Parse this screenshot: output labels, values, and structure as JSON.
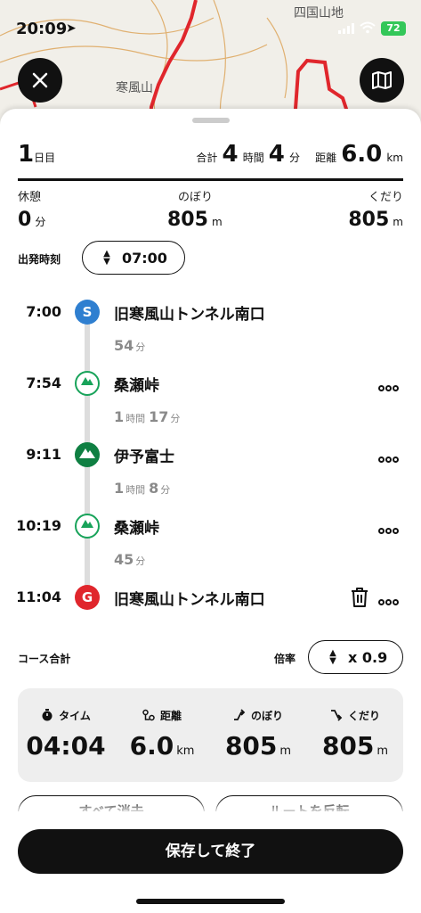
{
  "status_bar": {
    "time": "20:09",
    "battery": "72"
  },
  "map": {
    "labels": [
      "四国山地",
      "寒風山"
    ]
  },
  "header": {
    "day_num": "1",
    "day_unit": "日目",
    "total_label": "合計",
    "hours": "4",
    "hours_unit": "時間",
    "minutes": "4",
    "minutes_unit": "分",
    "distance_label": "距離",
    "distance": "6.0",
    "distance_unit": "km"
  },
  "stats": {
    "rest_label": "休憩",
    "rest_value": "0",
    "rest_unit": "分",
    "up_label": "のぼり",
    "up_value": "805",
    "up_unit": "m",
    "down_label": "くだり",
    "down_value": "805",
    "down_unit": "m"
  },
  "departure": {
    "label": "出発時刻",
    "time": "07:00"
  },
  "timeline": {
    "stops": [
      {
        "time": "7:00",
        "marker": "S",
        "name": "旧寒風山トンネル南口"
      },
      {
        "time": "7:54",
        "name": "桑瀬峠"
      },
      {
        "time": "9:11",
        "name": "伊予富士"
      },
      {
        "time": "10:19",
        "name": "桑瀬峠"
      },
      {
        "time": "11:04",
        "marker": "G",
        "name": "旧寒風山トンネル南口"
      }
    ],
    "segments": [
      {
        "m": "54",
        "m_unit": "分"
      },
      {
        "h": "1",
        "h_unit": "時間",
        "m": "17",
        "m_unit": "分"
      },
      {
        "h": "1",
        "h_unit": "時間",
        "m": "8",
        "m_unit": "分"
      },
      {
        "m": "45",
        "m_unit": "分"
      }
    ]
  },
  "course_total": {
    "label": "コース合計",
    "rate_label": "倍率",
    "rate_value": "x 0.9"
  },
  "summary": {
    "time_label": "タイム",
    "time_value": "04:04",
    "dist_label": "距離",
    "dist_value": "6.0",
    "dist_unit": "km",
    "up_label": "のぼり",
    "up_value": "805",
    "up_unit": "m",
    "down_label": "くだり",
    "down_value": "805",
    "down_unit": "m"
  },
  "actions": {
    "clear_all": "すべて消去",
    "reverse": "ルートを反転",
    "save": "保存して終了"
  },
  "colors": {
    "start": "#2f7fd0",
    "goal": "#e0262c",
    "pass": "#18a35a",
    "peak": "#0f7f42",
    "battery": "#34c759"
  }
}
